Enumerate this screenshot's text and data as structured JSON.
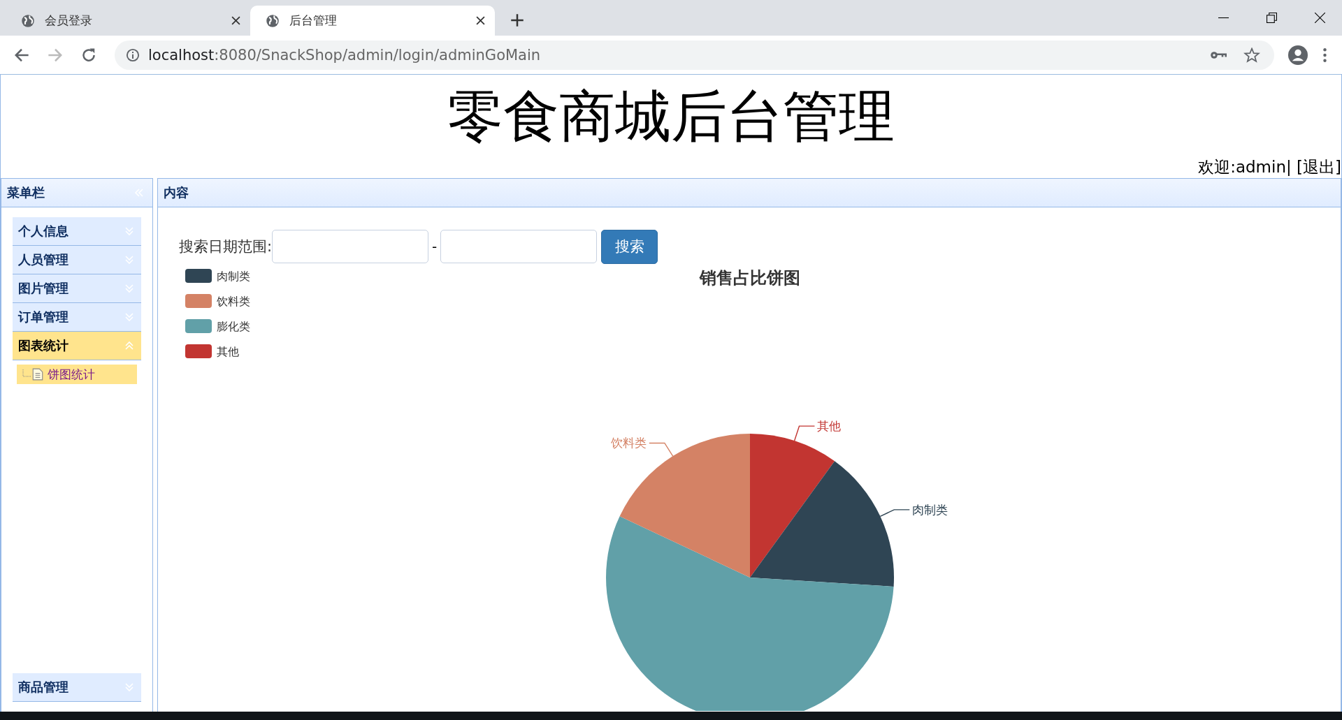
{
  "browser": {
    "tabs": [
      {
        "title": "会员登录",
        "selected": false
      },
      {
        "title": "后台管理",
        "selected": true
      }
    ],
    "url": {
      "host": "localhost",
      "path": ":8080/SnackShop/admin/login/adminGoMain"
    }
  },
  "header": {
    "title": "零食商城后台管理",
    "welcome": "欢迎:admin|",
    "logout": "[退出]"
  },
  "sidebar": {
    "title": "菜单栏",
    "items": [
      {
        "label": "个人信息",
        "expanded": false
      },
      {
        "label": "人员管理",
        "expanded": false
      },
      {
        "label": "图片管理",
        "expanded": false
      },
      {
        "label": "订单管理",
        "expanded": false
      },
      {
        "label": "图表统计",
        "expanded": true,
        "children": [
          {
            "label": "饼图统计",
            "selected": true
          }
        ]
      }
    ],
    "bottom_items": [
      {
        "label": "商品管理",
        "expanded": false
      }
    ]
  },
  "content": {
    "title": "内容",
    "search": {
      "label": "搜索日期范围:",
      "separator": "-",
      "button": "搜索"
    },
    "legend": [
      {
        "label": "肉制类",
        "color": "#2f4554"
      },
      {
        "label": "饮料类",
        "color": "#d48265"
      },
      {
        "label": "膨化类",
        "color": "#61a0a8"
      },
      {
        "label": "其他",
        "color": "#c23531"
      }
    ],
    "chart_data": {
      "type": "pie",
      "title": "销售占比饼图",
      "categories": [
        "其他",
        "肉制类",
        null,
        "饮料类"
      ],
      "values": [
        10,
        16,
        56,
        18
      ],
      "colors": [
        "#c23531",
        "#2f4554",
        "#61a0a8",
        "#d48265"
      ]
    }
  }
}
